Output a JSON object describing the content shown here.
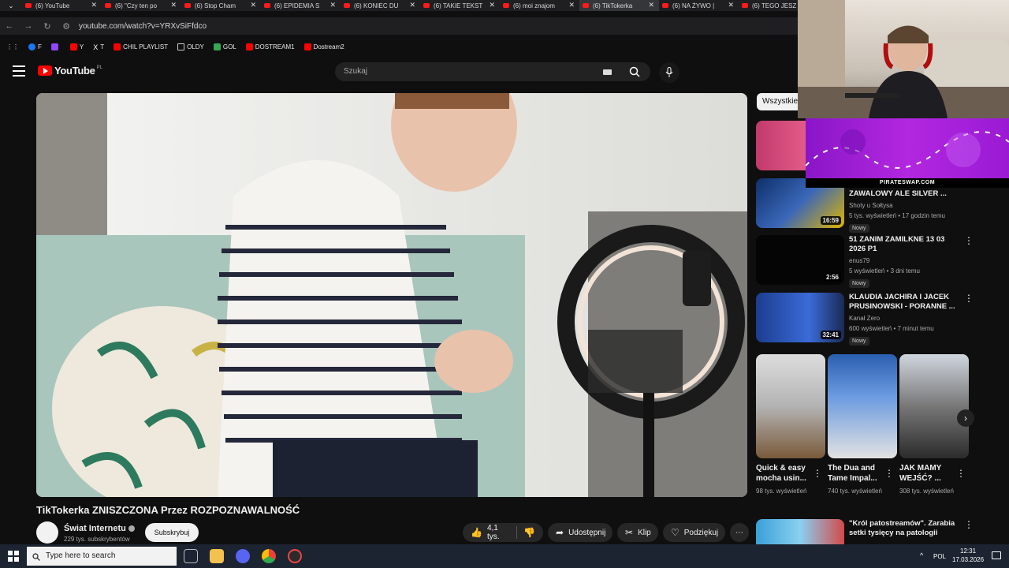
{
  "browser": {
    "tabs": [
      {
        "label": "(6) YouTube",
        "active": false
      },
      {
        "label": "(6) \"Czy ten po",
        "active": false
      },
      {
        "label": "(6) Stop Cham",
        "active": false
      },
      {
        "label": "(6) EPIDEMIA S",
        "active": false
      },
      {
        "label": "(6) KONIEC DU",
        "active": false
      },
      {
        "label": "(6) TAKIE TEKST",
        "active": false
      },
      {
        "label": "(6) moi znajom",
        "active": false
      },
      {
        "label": "(6) TikTokerka",
        "active": true
      },
      {
        "label": "(6) NA ŻYWO |",
        "active": false
      },
      {
        "label": "(6) TEGO JESZ",
        "active": false
      }
    ],
    "url": "youtube.com/watch?v=YRXvSiFfdco",
    "bookmarks": [
      {
        "label": "F",
        "color": "#1877f2"
      },
      {
        "label": "",
        "color": "#9146ff"
      },
      {
        "label": "Y",
        "color": "#ff0000"
      },
      {
        "label": "T",
        "color": "#ffffff"
      },
      {
        "label": "CHIL PLAYLIST",
        "color": "#ff0000"
      },
      {
        "label": "OLDY",
        "color": "#cccccc"
      },
      {
        "label": "GOL",
        "color": "#34a853"
      },
      {
        "label": "DOSTREAM1",
        "color": "#ff0000"
      },
      {
        "label": "Dostream2",
        "color": "#ff0000"
      }
    ]
  },
  "header": {
    "logo_text": "YouTube",
    "logo_region": "PL",
    "search_placeholder": "Szukaj"
  },
  "video": {
    "title": "TikTokerka ZNISZCZONA Przez ROZPOZNAWALNOŚĆ",
    "channel": "Świat Internetu",
    "subscribers": "229 tys. subskrybentów",
    "subscribe_label": "Subskrybuj",
    "likes": "4,1 tys.",
    "share_label": "Udostępnij",
    "clip_label": "Klip",
    "thanks_label": "Podziękuj"
  },
  "sidebar": {
    "chip": "Wszystkie",
    "videos": [
      {
        "title": "ZAWALOWY ALE SILVER ...",
        "channel": "Shoty u Sołtysa",
        "stats": "5 tys. wyświetleń • 17 godzin temu",
        "badge": "Nowy",
        "duration": "16:59"
      },
      {
        "title": "51 ZANIM ZAMILKNE 13 03 2026 P1",
        "channel": "enus79",
        "stats": "5 wyświetleń • 3 dni temu",
        "badge": "Nowy",
        "duration": "2:56"
      },
      {
        "title": "KLAUDIA JACHIRA I JACEK PRUSINOWSKI - PORANNE ...",
        "channel": "Kanał Zero",
        "stats": "600 wyświetleń • 7 minut temu",
        "badge": "Nowy",
        "duration": "32:41"
      },
      {
        "title": "\"Król patostreamów\". Zarabia setki tysięcy na patologii",
        "channel": "",
        "stats": "",
        "badge": "",
        "duration": ""
      }
    ],
    "shorts": [
      {
        "title": "Quick & easy mocha usin...",
        "views": "98 tys. wyświetleń"
      },
      {
        "title": "The Dua and Tame Impal...",
        "views": "740 tys. wyświetleń"
      },
      {
        "title": "JAK MAMY WEJŚĆ? ...",
        "views": "308 tys. wyświetleń"
      }
    ]
  },
  "overlay": {
    "sponsor": "PIRATESWAP.COM"
  },
  "taskbar": {
    "search_placeholder": "Type here to search",
    "language": "POL",
    "time": "12:31",
    "date": "17.03.2026"
  }
}
